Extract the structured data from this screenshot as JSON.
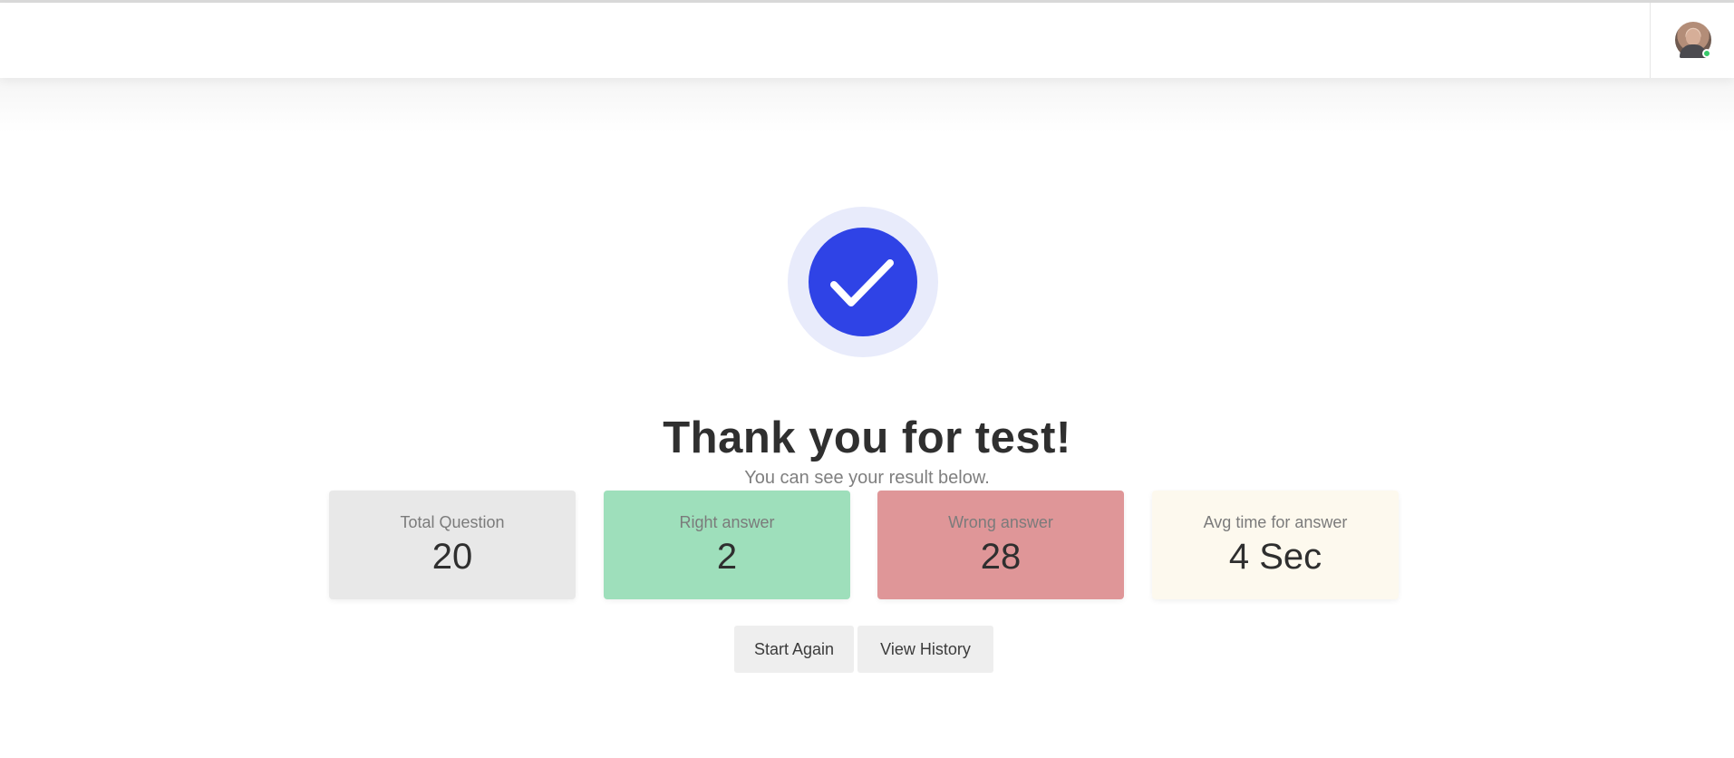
{
  "header": {
    "avatar_alt": "User avatar",
    "status": "online"
  },
  "result": {
    "title": "Thank you for test!",
    "subtitle": "You can see your result below.",
    "icon": "check-circle-icon",
    "accent_color": "#2f43e6"
  },
  "stats": [
    {
      "label": "Total Question",
      "value": "20",
      "color": "#e8e8e8"
    },
    {
      "label": "Right answer",
      "value": "2",
      "color": "#9edfbb"
    },
    {
      "label": "Wrong answer",
      "value": "28",
      "color": "#df9698"
    },
    {
      "label": "Avg time for answer",
      "value": "4 Sec",
      "color": "#fdf9ee"
    }
  ],
  "actions": {
    "start_again": "Start Again",
    "view_history": "View History"
  }
}
